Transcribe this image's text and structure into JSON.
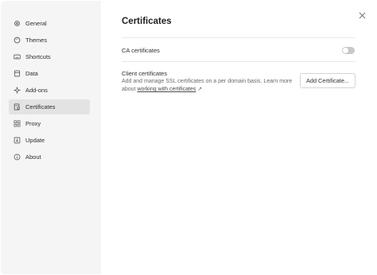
{
  "sidebar": {
    "items": [
      {
        "label": "General",
        "icon": "gear-icon"
      },
      {
        "label": "Themes",
        "icon": "palette-icon"
      },
      {
        "label": "Shortcuts",
        "icon": "keyboard-icon"
      },
      {
        "label": "Data",
        "icon": "database-icon"
      },
      {
        "label": "Add-ons",
        "icon": "sparkle-icon"
      },
      {
        "label": "Certificates",
        "icon": "certificate-icon",
        "active": true
      },
      {
        "label": "Proxy",
        "icon": "proxy-icon"
      },
      {
        "label": "Update",
        "icon": "update-icon"
      },
      {
        "label": "About",
        "icon": "info-icon"
      }
    ]
  },
  "main": {
    "title": "Certificates",
    "ca": {
      "label": "CA certificates",
      "enabled": false
    },
    "client": {
      "label": "Client certificates",
      "description": "Add and manage SSL certificates on a per domain basis. Learn more about",
      "link_text": "working with certificates",
      "link_arrow": "↗",
      "button_label": "Add Certificate..."
    }
  }
}
